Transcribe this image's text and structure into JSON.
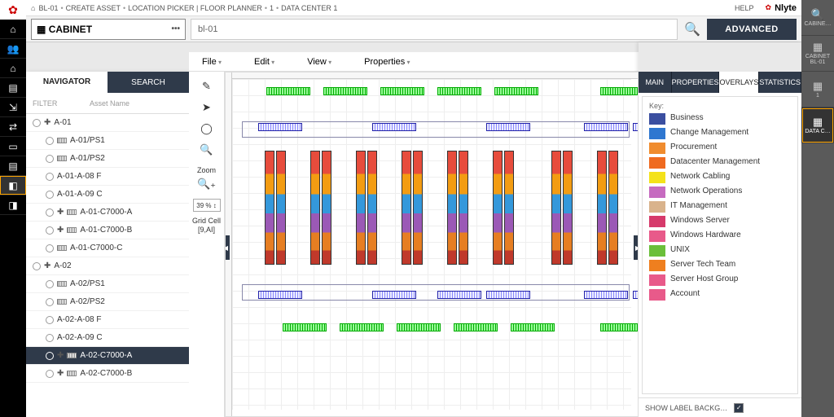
{
  "brand": "Nlyte",
  "help": "HELP",
  "breadcrumb": [
    "BL-01",
    "CREATE ASSET",
    "LOCATION PICKER | FLOOR PLANNER",
    "1",
    "DATA CENTER 1"
  ],
  "asset_type": {
    "label": "CABINET"
  },
  "search": {
    "value": "bl-01",
    "advanced": "ADVANCED"
  },
  "menus": [
    "File",
    "Edit",
    "View",
    "Properties"
  ],
  "left_tabs": {
    "navigator": "NAVIGATOR",
    "search": "SEARCH"
  },
  "filter": {
    "label": "FILTER",
    "placeholder": "Asset Name"
  },
  "tree": [
    {
      "label": "A-01",
      "level": 1,
      "exp": true
    },
    {
      "label": "A-01/PS1",
      "level": 2,
      "icon": "rack"
    },
    {
      "label": "A-01/PS2",
      "level": 2,
      "icon": "rack"
    },
    {
      "label": "A-01-A-08 F",
      "level": 2
    },
    {
      "label": "A-01-A-09 C",
      "level": 2
    },
    {
      "label": "A-01-C7000-A",
      "level": 2,
      "exp": true,
      "icon": "rack"
    },
    {
      "label": "A-01-C7000-B",
      "level": 2,
      "exp": true,
      "icon": "rack"
    },
    {
      "label": "A-01-C7000-C",
      "level": 2,
      "icon": "rack"
    },
    {
      "label": "A-02",
      "level": 1,
      "exp": true
    },
    {
      "label": "A-02/PS1",
      "level": 2,
      "icon": "rack"
    },
    {
      "label": "A-02/PS2",
      "level": 2,
      "icon": "rack"
    },
    {
      "label": "A-02-A-08 F",
      "level": 2
    },
    {
      "label": "A-02-A-09 C",
      "level": 2
    },
    {
      "label": "A-02-C7000-A",
      "level": 2,
      "exp": true,
      "icon": "rack",
      "selected": true
    },
    {
      "label": "A-02-C7000-B",
      "level": 2,
      "exp": true,
      "icon": "rack"
    }
  ],
  "tools": {
    "zoom_label": "Zoom",
    "zoom_value": "39",
    "zoom_pct": "%",
    "grid_label": "Grid Cell",
    "grid_value": "[9,AI]"
  },
  "right_tabs": [
    "MAIN",
    "PROPERTIES",
    "OVERLAYS",
    "STATISTICS"
  ],
  "right_active": "OVERLAYS",
  "key_title": "Key:",
  "key_items": [
    {
      "color": "#3b4fa0",
      "label": "Business"
    },
    {
      "color": "#2f77d0",
      "label": "Change Management"
    },
    {
      "color": "#f08c2e",
      "label": "Procurement"
    },
    {
      "color": "#ef6a1f",
      "label": "Datacenter Management"
    },
    {
      "color": "#f4e21a",
      "label": "Network Cabling"
    },
    {
      "color": "#c66bc0",
      "label": "Network Operations"
    },
    {
      "color": "#d9b38c",
      "label": "IT Management"
    },
    {
      "color": "#d63a6b",
      "label": "Windows Server"
    },
    {
      "color": "#e85a8a",
      "label": "Windows Hardware"
    },
    {
      "color": "#6bbf3a",
      "label": "UNIX"
    },
    {
      "color": "#ef7f1f",
      "label": "Server Tech Team"
    },
    {
      "color": "#e85a8a",
      "label": "Server Host Group"
    },
    {
      "color": "#e85a8a",
      "label": "Account"
    }
  ],
  "show_label": "SHOW LABEL BACKG…",
  "rightbar": [
    {
      "icon": "🔍",
      "label": "CABINE…"
    },
    {
      "icon": "▦",
      "label": "CABINET BL-01"
    },
    {
      "icon": "▦",
      "label": "1"
    },
    {
      "icon": "▦",
      "label": "DATA C…",
      "selected": true
    }
  ],
  "sidebar_icons": [
    "⌂",
    "👥",
    "⌂",
    "▤",
    "⇲",
    "⇄",
    "▭",
    "▤",
    "◧",
    "◨"
  ]
}
